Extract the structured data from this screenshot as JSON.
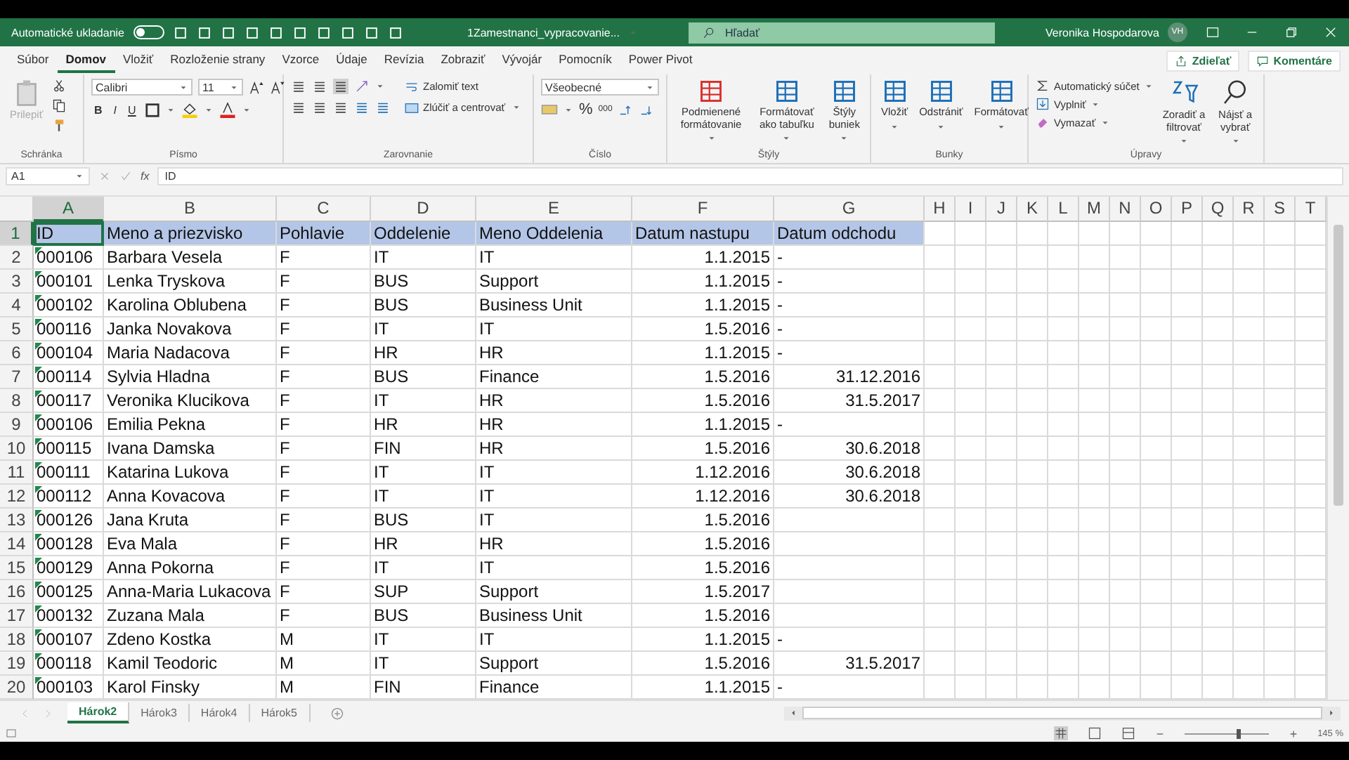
{
  "title_bar": {
    "autosave": {
      "label": "Automatické ukladanie",
      "on": false
    },
    "file_name": "1Zamestnanci_vypracovanie...",
    "search": {
      "placeholder": "Hľadať"
    },
    "user": {
      "name": "Veronika Hospodarova",
      "initials": "VH"
    }
  },
  "menu_tabs": [
    {
      "label": "Súbor",
      "selected": false
    },
    {
      "label": "Domov",
      "selected": true
    },
    {
      "label": "Vložiť",
      "selected": false
    },
    {
      "label": "Rozloženie strany",
      "selected": false
    },
    {
      "label": "Vzorce",
      "selected": false
    },
    {
      "label": "Údaje",
      "selected": false
    },
    {
      "label": "Revízia",
      "selected": false
    },
    {
      "label": "Zobraziť",
      "selected": false
    },
    {
      "label": "Vývojár",
      "selected": false
    },
    {
      "label": "Pomocník",
      "selected": false
    },
    {
      "label": "Power Pivot",
      "selected": false
    }
  ],
  "share": "Zdieľať",
  "comments": "Komentáre",
  "ribbon": {
    "clipboard": {
      "paste": "Prilepiť",
      "paste_disabled": true,
      "label": "Schránka"
    },
    "font": {
      "name": "Calibri",
      "size": "11",
      "buttons": [
        "B",
        "I",
        "U"
      ],
      "label": "Písmo"
    },
    "alignment": {
      "wrap": "Zalomiť text",
      "merge": "Zlúčiť a centrovať",
      "label": "Zarovnanie"
    },
    "number": {
      "format": "Všeobecné",
      "percent": "%",
      "thousands": "000",
      "label": "Číslo"
    },
    "styles": {
      "items": [
        "Podmienené formátovanie",
        "Formátovať ako tabuľku",
        "Štýly buniek"
      ],
      "label": "Štýly"
    },
    "cells": {
      "items": [
        "Vložiť",
        "Odstrániť",
        "Formátovať"
      ],
      "label": "Bunky"
    },
    "editing": {
      "small": [
        "Automatický súčet",
        "Vyplniť",
        "Vymazať"
      ],
      "large": [
        "Zoradiť a filtrovať",
        "Nájsť a vybrať"
      ],
      "label": "Úpravy"
    }
  },
  "formula_bar": {
    "name_box": "A1",
    "fx": "fx",
    "value": "ID"
  },
  "sheet": {
    "columns": [
      {
        "label": "A",
        "selected": true,
        "kind": "text",
        "flagged": true
      },
      {
        "label": "B",
        "selected": false,
        "kind": "text"
      },
      {
        "label": "C",
        "selected": false,
        "kind": "text"
      },
      {
        "label": "D",
        "selected": false,
        "kind": "text"
      },
      {
        "label": "E",
        "selected": false,
        "kind": "text"
      },
      {
        "label": "F",
        "selected": false,
        "kind": "number"
      },
      {
        "label": "G",
        "selected": false,
        "kind": "number"
      },
      {
        "label": "H",
        "selected": false
      },
      {
        "label": "I",
        "selected": false
      },
      {
        "label": "J",
        "selected": false
      },
      {
        "label": "K",
        "selected": false
      },
      {
        "label": "L",
        "selected": false
      },
      {
        "label": "M",
        "selected": false
      },
      {
        "label": "N",
        "selected": false
      },
      {
        "label": "O",
        "selected": false
      },
      {
        "label": "P",
        "selected": false
      },
      {
        "label": "Q",
        "selected": false
      },
      {
        "label": "R",
        "selected": false
      },
      {
        "label": "S",
        "selected": false
      },
      {
        "label": "T",
        "selected": false
      }
    ],
    "rows": [
      {
        "n": "1",
        "kind": "header",
        "selected": true,
        "cells": [
          "ID",
          "Meno a priezvisko",
          "Pohlavie",
          "Oddelenie",
          "Meno Oddelenia",
          "Datum nastupu",
          "Datum odchodu"
        ]
      },
      {
        "n": "2",
        "kind": "data",
        "selected": false,
        "cells": [
          "000106",
          "Barbara Vesela",
          "F",
          "IT",
          "IT",
          "1.1.2015",
          {
            "kind": "text",
            "text": "-"
          }
        ]
      },
      {
        "n": "3",
        "kind": "data",
        "selected": false,
        "cells": [
          "000101",
          "Lenka Tryskova",
          "F",
          "BUS",
          "Support",
          "1.1.2015",
          {
            "kind": "text",
            "text": "-"
          }
        ]
      },
      {
        "n": "4",
        "kind": "data",
        "selected": false,
        "cells": [
          "000102",
          "Karolina Oblubena",
          "F",
          "BUS",
          "Business Unit",
          "1.1.2015",
          {
            "kind": "text",
            "text": "-"
          }
        ]
      },
      {
        "n": "5",
        "kind": "data",
        "selected": false,
        "cells": [
          "000116",
          "Janka Novakova",
          "F",
          "IT",
          "IT",
          "1.5.2016",
          {
            "kind": "text",
            "text": "-"
          }
        ]
      },
      {
        "n": "6",
        "kind": "data",
        "selected": false,
        "cells": [
          "000104",
          "Maria Nadacova",
          "F",
          "HR",
          "HR",
          "1.1.2015",
          {
            "kind": "text",
            "text": "-"
          }
        ]
      },
      {
        "n": "7",
        "kind": "data",
        "selected": false,
        "cells": [
          "000114",
          "Sylvia Hladna",
          "F",
          "BUS",
          "Finance",
          "1.5.2016",
          "31.12.2016"
        ]
      },
      {
        "n": "8",
        "kind": "data",
        "selected": false,
        "cells": [
          "000117",
          "Veronika Klucikova",
          "F",
          "IT",
          "HR",
          "1.5.2016",
          "31.5.2017"
        ]
      },
      {
        "n": "9",
        "kind": "data",
        "selected": false,
        "cells": [
          "000106",
          "Emilia Pekna",
          "F",
          "HR",
          "HR",
          "1.1.2015",
          {
            "kind": "text",
            "text": "-"
          }
        ]
      },
      {
        "n": "10",
        "kind": "data",
        "selected": false,
        "cells": [
          "000115",
          "Ivana Damska",
          "F",
          "FIN",
          "HR",
          "1.5.2016",
          "30.6.2018"
        ]
      },
      {
        "n": "11",
        "kind": "data",
        "selected": false,
        "cells": [
          "000111",
          "Katarina Lukova",
          "F",
          "IT",
          "IT",
          "1.12.2016",
          "30.6.2018"
        ]
      },
      {
        "n": "12",
        "kind": "data",
        "selected": false,
        "cells": [
          "000112",
          "Anna Kovacova",
          "F",
          "IT",
          "IT",
          "1.12.2016",
          "30.6.2018"
        ]
      },
      {
        "n": "13",
        "kind": "data",
        "selected": false,
        "cells": [
          "000126",
          "Jana Kruta",
          "F",
          "BUS",
          "IT",
          "1.5.2016"
        ]
      },
      {
        "n": "14",
        "kind": "data",
        "selected": false,
        "cells": [
          "000128",
          "Eva Mala",
          "F",
          "HR",
          "HR",
          "1.5.2016"
        ]
      },
      {
        "n": "15",
        "kind": "data",
        "selected": false,
        "cells": [
          "000129",
          "Anna Pokorna",
          "F",
          "IT",
          "IT",
          "1.5.2016"
        ]
      },
      {
        "n": "16",
        "kind": "data",
        "selected": false,
        "cells": [
          "000125",
          "Anna-Maria Lukacova",
          "F",
          "SUP",
          "Support",
          "1.5.2017"
        ]
      },
      {
        "n": "17",
        "kind": "data",
        "selected": false,
        "cells": [
          "000132",
          "Zuzana Mala",
          "F",
          "BUS",
          "Business Unit",
          "1.5.2016"
        ]
      },
      {
        "n": "18",
        "kind": "data",
        "selected": false,
        "cells": [
          "000107",
          "Zdeno Kostka",
          "M",
          "IT",
          "IT",
          "1.1.2015",
          {
            "kind": "text",
            "text": "-"
          }
        ]
      },
      {
        "n": "19",
        "kind": "data",
        "selected": false,
        "cells": [
          "000118",
          "Kamil Teodoric",
          "M",
          "IT",
          "Support",
          "1.5.2016",
          "31.5.2017"
        ]
      },
      {
        "n": "20",
        "kind": "data",
        "selected": false,
        "cells": [
          "000103",
          "Karol Finsky",
          "M",
          "FIN",
          "Finance",
          "1.1.2015",
          {
            "kind": "text",
            "text": "-"
          }
        ]
      }
    ]
  },
  "sheet_tabs": [
    {
      "label": "Hárok2",
      "selected": true
    },
    {
      "label": "Hárok3",
      "selected": false
    },
    {
      "label": "Hárok4",
      "selected": false
    },
    {
      "label": "Hárok5",
      "selected": false
    }
  ],
  "status_bar": {
    "zoom": "145 %",
    "zoom_slider": {
      "level": 0.62
    }
  }
}
